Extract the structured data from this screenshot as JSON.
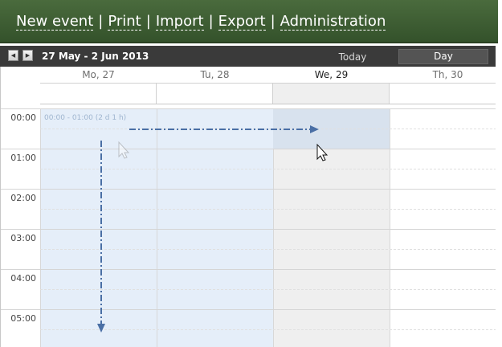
{
  "menu": {
    "items": [
      "New event",
      "Print",
      "Import",
      "Export",
      "Administration"
    ],
    "separator": "|"
  },
  "toolbar": {
    "prev_icon": "◀",
    "next_icon": "▶",
    "date_range": "27 May - 2 Jun 2013",
    "today_label": "Today",
    "day_label": "Day"
  },
  "calendar": {
    "days": [
      "Mo, 27",
      "Tu, 28",
      "We, 29",
      "Th, 30"
    ],
    "current_day": "We, 29",
    "hours": [
      "00:00",
      "01:00",
      "02:00",
      "03:00",
      "04:00",
      "05:00"
    ]
  },
  "selection": {
    "label": "00:00 - 01:00 (2 d 1 h)"
  },
  "colors": {
    "menu_bg": "#3f5f35",
    "toolbar_bg": "#3a3a3a",
    "selection": "#dce6f2",
    "today_column": "#efefef",
    "arrow": "#4a6fa5"
  },
  "icons": [
    "arrow-pointer-icon",
    "arrow-pointer-icon"
  ]
}
